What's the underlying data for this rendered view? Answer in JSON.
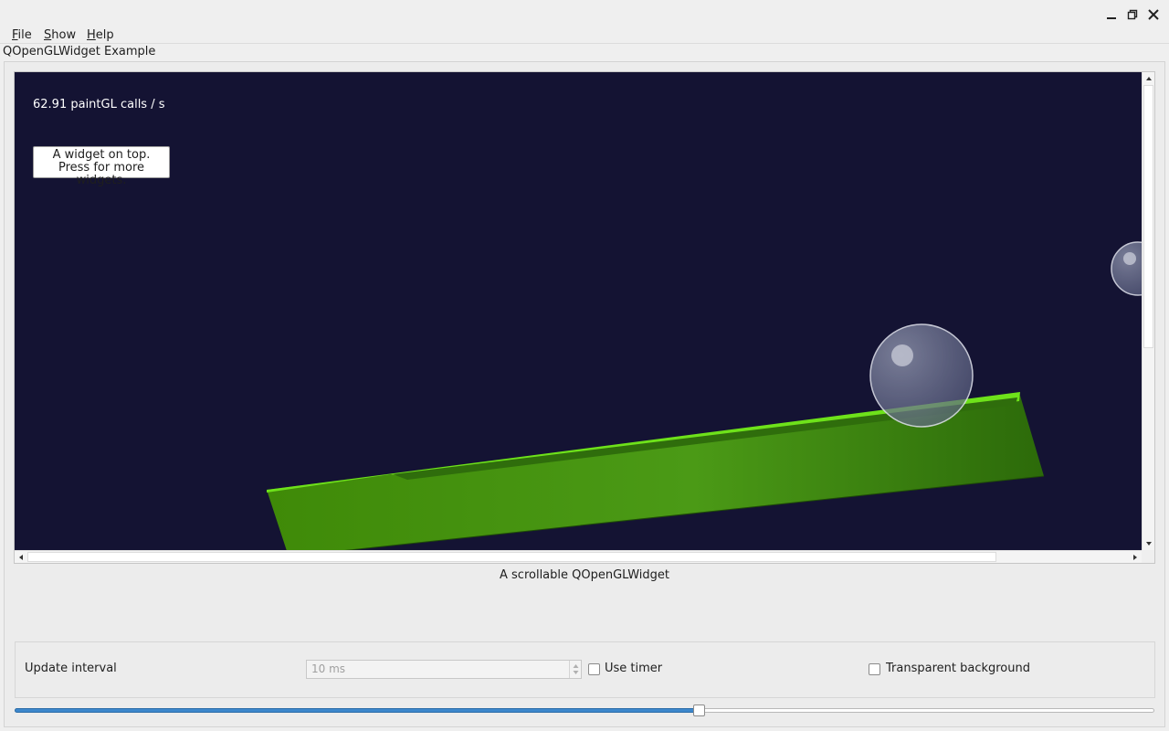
{
  "window": {
    "tab_title": "QOpenGLWidget Example"
  },
  "menubar": {
    "items": [
      {
        "mnemonic": "F",
        "rest": "ile"
      },
      {
        "mnemonic": "S",
        "rest": "how"
      },
      {
        "mnemonic": "H",
        "rest": "elp"
      }
    ]
  },
  "gl_view": {
    "fps_label": "62.91 paintGL calls / s",
    "top_button_line1": "A widget on top.",
    "top_button_line2": "Press for more widgets.",
    "background_color": "#141333",
    "object_color": "#4a9a10"
  },
  "caption": "A scrollable QOpenGLWidget",
  "controls": {
    "update_interval_label": "Update interval",
    "interval_value": "10 ms",
    "use_timer_label": "Use timer",
    "use_timer_checked": false,
    "transparent_label": "Transparent background",
    "transparent_checked": false
  },
  "slider": {
    "value_fraction": 0.6,
    "accent_color": "#3d87cc"
  }
}
